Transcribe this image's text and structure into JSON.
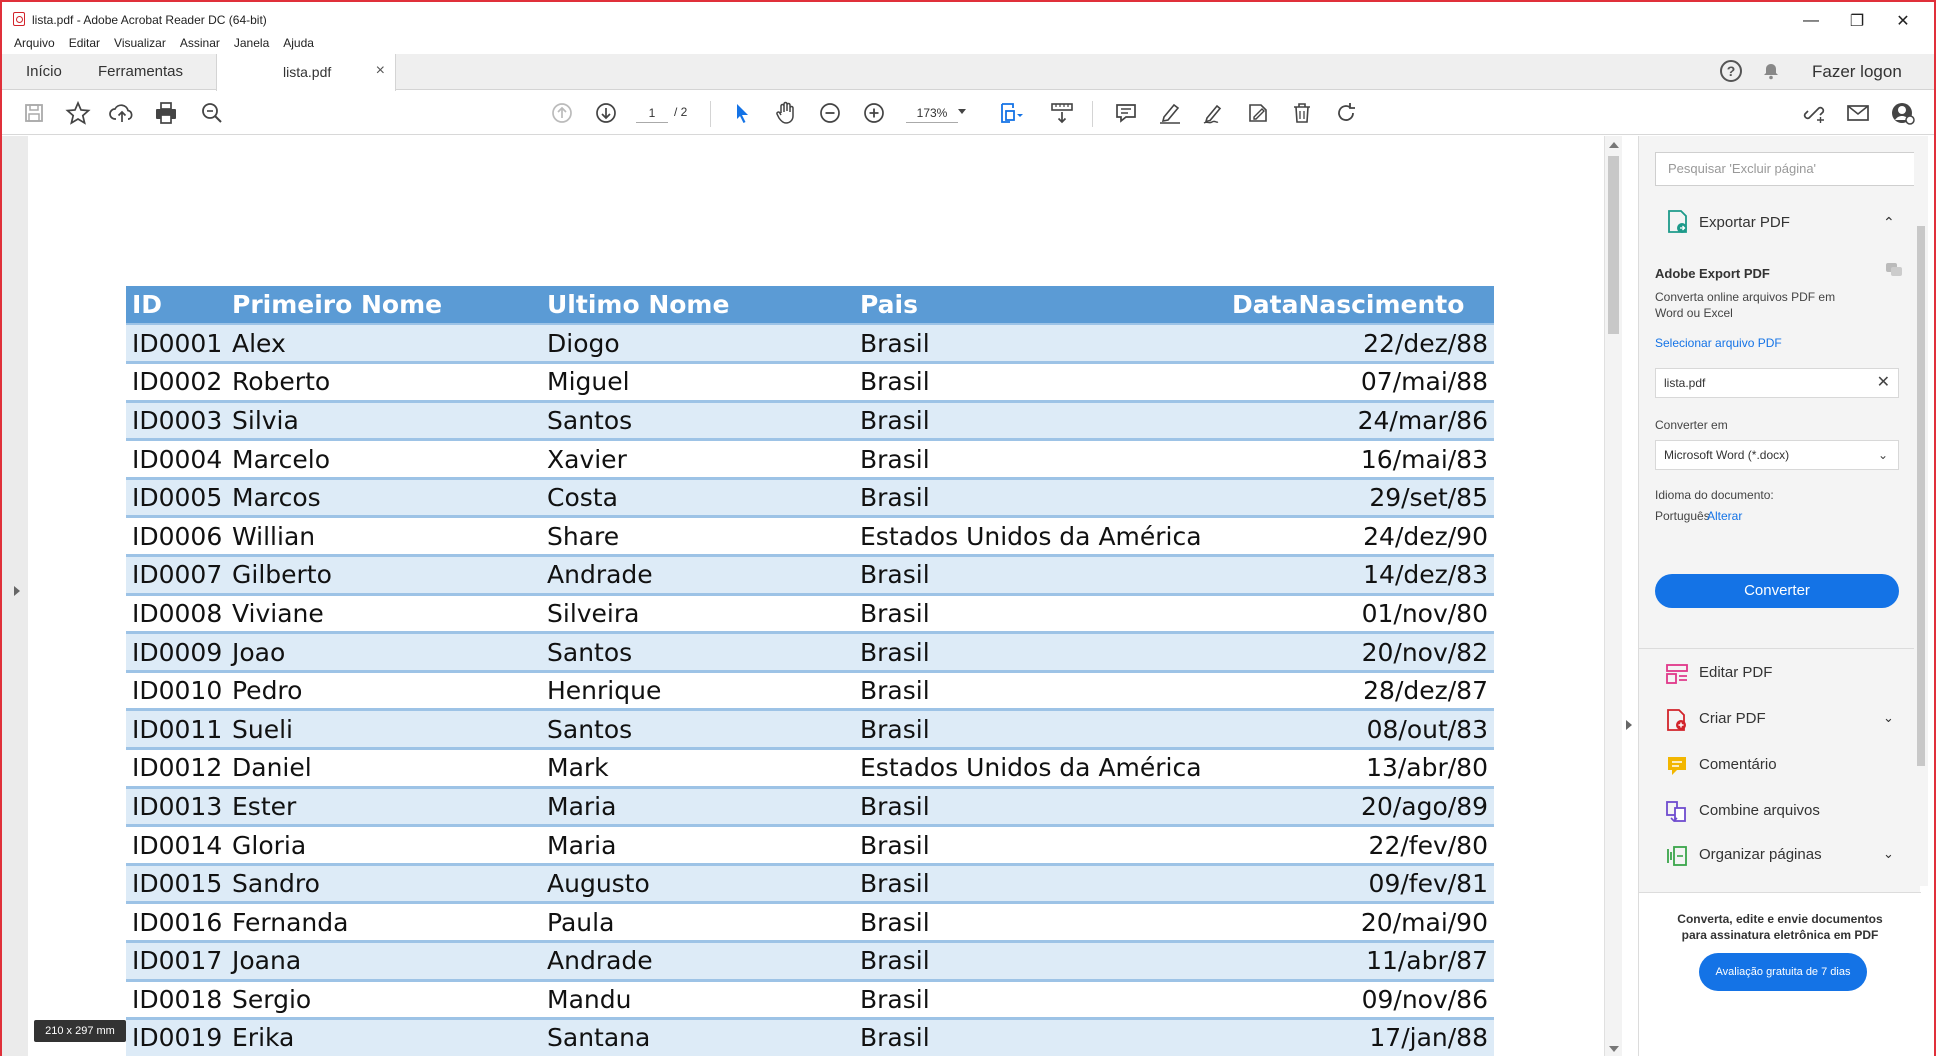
{
  "window": {
    "title": "lista.pdf - Adobe Acrobat Reader DC (64-bit)",
    "min_glyph": "—",
    "restore_glyph": "❐",
    "close_glyph": "✕"
  },
  "menu": [
    "Arquivo",
    "Editar",
    "Visualizar",
    "Assinar",
    "Janela",
    "Ajuda"
  ],
  "tabs": {
    "home": "Início",
    "tools": "Ferramentas",
    "file": "lista.pdf",
    "close_glyph": "×"
  },
  "topright": {
    "help": "?",
    "login": "Fazer logon"
  },
  "toolbar": {
    "page_current": "1",
    "page_total": "/ 2",
    "zoom": "173%",
    "icons": [
      "save-icon",
      "star-icon",
      "cloud-upload-icon",
      "print-icon",
      "zoom-search-icon",
      "page-up-icon",
      "page-down-icon",
      "select-cursor-icon",
      "hand-icon",
      "zoom-out-icon",
      "zoom-in-icon",
      "fit-page-icon",
      "scroll-mode-icon",
      "comment-icon",
      "highlight-icon",
      "sign-icon",
      "fill-sign-icon",
      "delete-icon",
      "rotate-icon",
      "link-icon",
      "email-icon",
      "account-icon"
    ]
  },
  "table": {
    "headers": [
      "ID",
      "Primeiro Nome",
      "Ultimo Nome",
      "Pais",
      "DataNascimento"
    ],
    "rows": [
      [
        "ID0001",
        "Alex",
        "Diogo",
        "Brasil",
        "22/dez/88"
      ],
      [
        "ID0002",
        "Roberto",
        "Miguel",
        "Brasil",
        "07/mai/88"
      ],
      [
        "ID0003",
        "Silvia",
        "Santos",
        "Brasil",
        "24/mar/86"
      ],
      [
        "ID0004",
        "Marcelo",
        "Xavier",
        "Brasil",
        "16/mai/83"
      ],
      [
        "ID0005",
        "Marcos",
        "Costa",
        "Brasil",
        "29/set/85"
      ],
      [
        "ID0006",
        "Willian",
        "Share",
        "Estados Unidos da América",
        "24/dez/90"
      ],
      [
        "ID0007",
        "Gilberto",
        "Andrade",
        "Brasil",
        "14/dez/83"
      ],
      [
        "ID0008",
        "Viviane",
        "Silveira",
        "Brasil",
        "01/nov/80"
      ],
      [
        "ID0009",
        "Joao",
        "Santos",
        "Brasil",
        "20/nov/82"
      ],
      [
        "ID0010",
        "Pedro",
        "Henrique",
        "Brasil",
        "28/dez/87"
      ],
      [
        "ID0011",
        "Sueli",
        "Santos",
        "Brasil",
        "08/out/83"
      ],
      [
        "ID0012",
        "Daniel",
        "Mark",
        "Estados Unidos da América",
        "13/abr/80"
      ],
      [
        "ID0013",
        "Ester",
        "Maria",
        "Brasil",
        "20/ago/89"
      ],
      [
        "ID0014",
        "Gloria",
        "Maria",
        "Brasil",
        "22/fev/80"
      ],
      [
        "ID0015",
        "Sandro",
        "Augusto",
        "Brasil",
        "09/fev/81"
      ],
      [
        "ID0016",
        "Fernanda",
        "Paula",
        "Brasil",
        "20/mai/90"
      ],
      [
        "ID0017",
        "Joana",
        "Andrade",
        "Brasil",
        "11/abr/87"
      ],
      [
        "ID0018",
        "Sergio",
        "Mandu",
        "Brasil",
        "09/nov/86"
      ],
      [
        "ID0019",
        "Erika",
        "Santana",
        "Brasil",
        "17/jan/88"
      ]
    ]
  },
  "page_size": "210 x 297 mm",
  "right_pane": {
    "search_placeholder": "Pesquisar 'Excluir página'",
    "export_title": "Exportar PDF",
    "export_chevron": "⌃",
    "adobe_export": "Adobe Export PDF",
    "desc_line1": "Converta online arquivos PDF em",
    "desc_line2": "Word ou Excel",
    "select_file": "Selecionar arquivo PDF",
    "file_name": "lista.pdf",
    "file_clear": "✕",
    "convert_to_label": "Converter em",
    "convert_to_value": "Microsoft Word (*.docx)",
    "select_chevron": "⌄",
    "doc_lang_label": "Idioma do documento:",
    "doc_lang_value": "Português",
    "doc_lang_change": "Alterar",
    "convert_button": "Converter",
    "tools": [
      {
        "label": "Editar PDF",
        "chevron": ""
      },
      {
        "label": "Criar PDF",
        "chevron": "⌄"
      },
      {
        "label": "Comentário",
        "chevron": ""
      },
      {
        "label": "Combine arquivos",
        "chevron": ""
      },
      {
        "label": "Organizar páginas",
        "chevron": "⌄"
      }
    ],
    "promo_line1": "Converta, edite e envie documentos",
    "promo_line2": "para assinatura eletrônica em PDF",
    "promo_button": "Avaliação gratuita de 7 dias"
  },
  "colors": {
    "header_blue": "#5b9bd5",
    "row_alt": "#ddebf7",
    "accent": "#1473e6",
    "window_border": "#e0303a"
  }
}
